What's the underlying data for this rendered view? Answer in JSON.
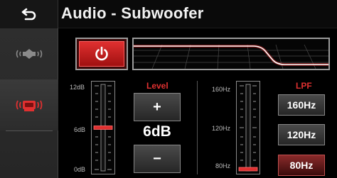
{
  "header": {
    "title": "Audio - Subwoofer",
    "back_icon": "back-arrow-icon"
  },
  "sidebar": {
    "items": [
      {
        "name": "speakers",
        "icon": "speakers-icon",
        "active": false
      },
      {
        "name": "subwoofer",
        "icon": "subwoofer-icon",
        "active": true
      }
    ]
  },
  "power": {
    "icon": "power-icon",
    "state": "on"
  },
  "level": {
    "title": "Level",
    "value": "6dB",
    "plus_label": "+",
    "minus_label": "−",
    "scale": {
      "top": "12dB",
      "mid": "6dB",
      "bottom": "0dB"
    },
    "fraction": 0.5
  },
  "lpf": {
    "title": "LPF",
    "scale": {
      "top": "160Hz",
      "mid": "120Hz",
      "bottom": "80Hz"
    },
    "options": [
      "160Hz",
      "120Hz",
      "80Hz"
    ],
    "selected": "80Hz",
    "fraction": 0.0
  },
  "colors": {
    "accent": "#e03030",
    "background": "#000000",
    "sidebar": "#2a2a2a",
    "border": "#9a9a9a"
  }
}
